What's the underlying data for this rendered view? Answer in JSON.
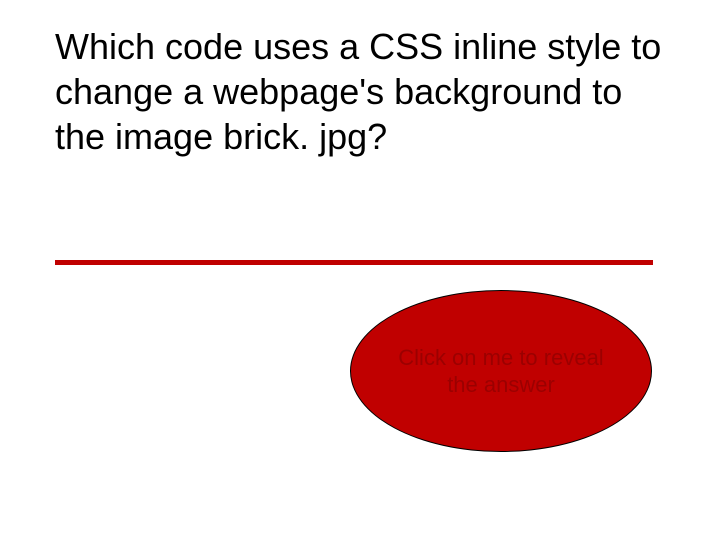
{
  "slide": {
    "title": "Which code uses a CSS inline style to change a webpage's background to the image brick. jpg?",
    "oval_text": "Click on me to reveal the answer",
    "colors": {
      "accent": "#c00000",
      "oval_text": "#9b0000",
      "text": "#000000",
      "background": "#ffffff"
    }
  }
}
